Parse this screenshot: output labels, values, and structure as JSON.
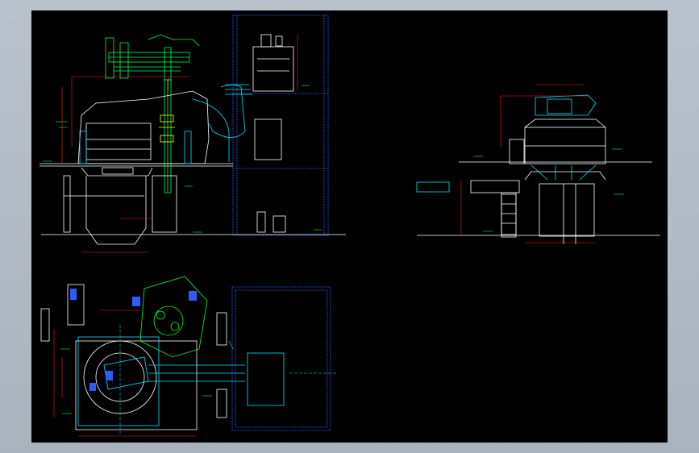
{
  "window": {
    "background": "#aeb8c2",
    "canvas_color": "#000000"
  },
  "colors": {
    "white": "#ffffff",
    "green": "#00ff3a",
    "red": "#ff1a1a",
    "blue": "#2d5bff",
    "cyan": "#00e5ff",
    "yellow": "#ffff00"
  },
  "views": {
    "front_elevation": "front-elevation",
    "side_elevation": "side-elevation",
    "plan_view": "plan-view"
  }
}
